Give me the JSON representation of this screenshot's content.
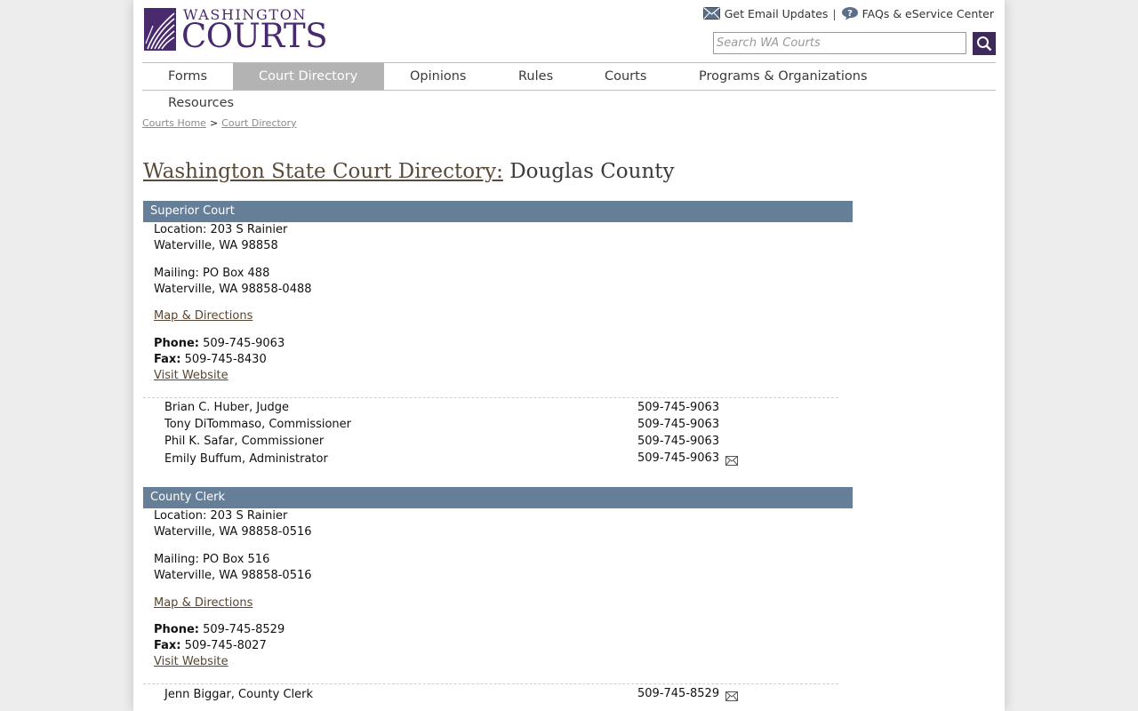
{
  "header": {
    "logo_line1": "WASHINGTON",
    "logo_line2": "COURTS",
    "email_updates": "Get Email Updates",
    "separator": "|",
    "faqs": "FAQs & eService Center",
    "search_placeholder": "Search WA Courts",
    "accent": "#4a2a6e"
  },
  "nav": {
    "items": [
      "Forms",
      "Court Directory",
      "Opinions",
      "Rules",
      "Courts",
      "Programs & Organizations",
      "Resources"
    ],
    "active": "Court Directory"
  },
  "breadcrumb": {
    "home": "Courts Home",
    "sep": ">",
    "current": "Court Directory"
  },
  "title": {
    "link": "Washington State Court Directory:",
    "county": "Douglas County"
  },
  "sections": [
    {
      "name": "Superior Court",
      "location_label": "Location:",
      "location_line1": "203 S Rainier",
      "location_line2": "Waterville, WA 98858",
      "mailing_label": "Mailing:",
      "mailing_line1": "PO Box 488",
      "mailing_line2": "Waterville, WA 98858-0488",
      "map_link": "Map & Directions",
      "phone_label": "Phone:",
      "phone": "509-745-9063",
      "fax_label": "Fax:",
      "fax": "509-745-8430",
      "website": "Visit Website",
      "staff": [
        {
          "name": "Brian C. Huber, Judge",
          "phone": "509-745-9063"
        },
        {
          "name": "Tony DiTommaso, Commissioner",
          "phone": "509-745-9063"
        },
        {
          "name": "Phil K. Safar, Commissioner",
          "phone": "509-745-9063"
        },
        {
          "name": "Emily Buffum, Administrator",
          "phone": "509-745-9063"
        }
      ]
    },
    {
      "name": "County Clerk",
      "location_label": "Location:",
      "location_line1": "203 S Rainier",
      "location_line2": "Waterville, WA 98858-0516",
      "mailing_label": "Mailing:",
      "mailing_line1": "PO Box 516",
      "mailing_line2": "Waterville, WA 98858-0516",
      "map_link": "Map & Directions",
      "phone_label": "Phone:",
      "phone": "509-745-8529",
      "fax_label": "Fax:",
      "fax": "509-745-8027",
      "website": "Visit Website",
      "staff": [
        {
          "name": "Jenn Biggar, County Clerk",
          "phone": "509-745-8529"
        }
      ]
    }
  ],
  "colors": {
    "section_header": "#667f99",
    "nav_active": "#b3b3b3",
    "search_button": "#3e2a5a"
  }
}
